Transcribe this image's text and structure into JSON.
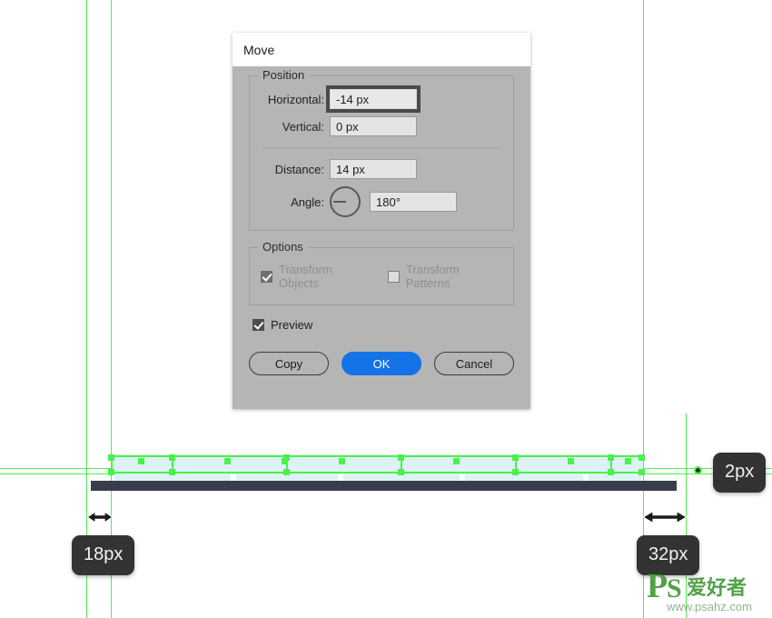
{
  "app": {
    "background_color": "#ffffff",
    "guide_color": "#4cf04c",
    "artwork_color": "#383d4c",
    "selection_fill": "#ddf2f5"
  },
  "dialog": {
    "title": "Move",
    "position_group": {
      "legend": "Position",
      "fields": [
        {
          "label": "Horizontal:",
          "value": "-14 px",
          "focused": true
        },
        {
          "label": "Vertical:",
          "value": "0 px",
          "focused": false
        },
        {
          "label": "Distance:",
          "value": "14 px",
          "focused": false
        },
        {
          "label": "Angle:",
          "value": "180°",
          "focused": false
        }
      ],
      "angle_degrees": 180
    },
    "options_group": {
      "legend": "Options",
      "checkboxes": [
        {
          "label": "Transform Objects",
          "checked": true,
          "enabled": false
        },
        {
          "label": "Transform Patterns",
          "checked": false,
          "enabled": false
        }
      ]
    },
    "preview": {
      "label": "Preview",
      "checked": true
    },
    "buttons": [
      {
        "label": "Copy",
        "style": "secondary"
      },
      {
        "label": "OK",
        "style": "primary"
      },
      {
        "label": "Cancel",
        "style": "secondary"
      }
    ],
    "accent_color": "#1473e6"
  },
  "measurements": [
    {
      "name": "left-gap",
      "value": "18px"
    },
    {
      "name": "right-gap",
      "value": "32px"
    },
    {
      "name": "stroke-height",
      "value": "2px"
    }
  ],
  "watermark": {
    "brand": "PS",
    "brand_cn": "爱好者",
    "url": "www.psahz.com"
  }
}
